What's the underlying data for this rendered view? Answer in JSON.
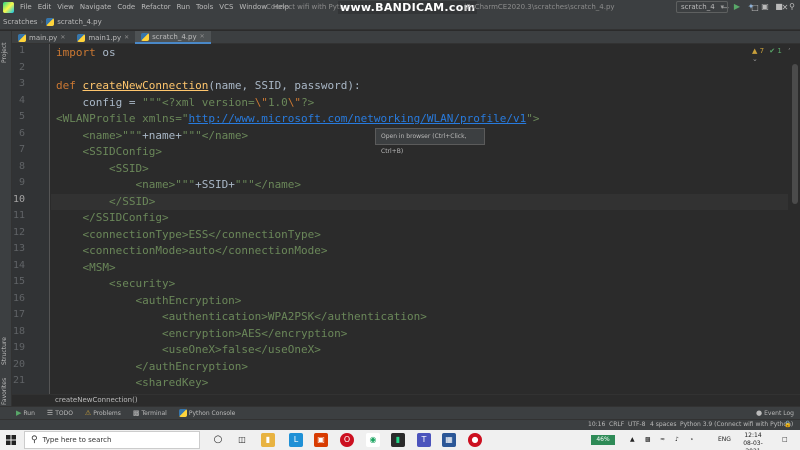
{
  "menu": [
    "File",
    "Edit",
    "View",
    "Navigate",
    "Code",
    "Refactor",
    "Run",
    "Tools",
    "VCS",
    "Window",
    "Help"
  ],
  "window": {
    "title_fragment": "Connect wifi with Python",
    "watermark": "www.BANDICAM.com",
    "path_fragment": "|PyCharmCE2020.3\\scratches\\scratch_4.py"
  },
  "nav": {
    "breadcrumb": [
      "Scratches",
      "scratch_4.py"
    ],
    "run_config": "scratch_4"
  },
  "tool_strip": {
    "project": "Project",
    "structure": "Structure",
    "favorites": "Favorites"
  },
  "tabs": [
    {
      "label": "main.py"
    },
    {
      "label": "main1.py"
    },
    {
      "label": "scratch_4.py"
    }
  ],
  "inspections": {
    "warnings": "▲ 7",
    "weak": "✔ 1"
  },
  "line_numbers": [
    "1",
    "2",
    "3",
    "4",
    "5",
    "6",
    "7",
    "8",
    "9",
    "10",
    "11",
    "12",
    "13",
    "14",
    "15",
    "16",
    "17",
    "18",
    "19",
    "20",
    "21"
  ],
  "code": {
    "l1_kw": "import",
    "l1_rest": " os",
    "l3_kw": "def ",
    "l3_fn": "createNewConnection",
    "l3_rest": "(name, SSID, password):",
    "l4_a": "    config = ",
    "l4_b": "\"\"\"<?xml version=",
    "l4_c": "\\\"",
    "l4_d": "1.0",
    "l4_e": "\\\"",
    "l4_f": "?>",
    "l5_a": "<WLANProfile ",
    "l5_b": "xmlns=\"",
    "l5_url": "http://www.microsoft.com/networking/WLAN/profile/v1",
    "l5_c": "\">",
    "l6_a": "    <name>\"\"\"",
    "l6_b": "+name+",
    "l6_c": "\"\"\"</name>",
    "l7": "    <SSIDConfig>",
    "l8": "        <SSID>",
    "l9_a": "            <name>\"\"\"",
    "l9_b": "+SSID+",
    "l9_c": "\"\"\"</name>",
    "l10": "        </SSID>",
    "l11": "    </SSIDConfig>",
    "l12": "    <connectionType>ESS</connectionType>",
    "l13": "    <connectionMode>auto</connectionMode>",
    "l14": "    <MSM>",
    "l15": "        <security>",
    "l16": "            <authEncryption>",
    "l17": "                <authentication>WPA2PSK</authentication>",
    "l18": "                <encryption>AES</encryption>",
    "l19": "                <useOneX>false</useOneX>",
    "l20": "            </authEncryption>",
    "l21": "            <sharedKey>"
  },
  "tooltip": "Open in browser (Ctrl+Click, Ctrl+B)",
  "breadcrumb_bottom": "createNewConnection()",
  "tool_windows": [
    "Run",
    "TODO",
    "Problems",
    "Terminal",
    "Python Console"
  ],
  "event_log": "Event Log",
  "status": {
    "position": "10:16",
    "line_sep": "CRLF",
    "encoding": "UTF-8",
    "indent": "4 spaces",
    "interpreter": "Python 3.9 (Connect wifi with Python)"
  },
  "taskbar": {
    "search_placeholder": "Type here to search",
    "battery": "46%",
    "language": "ENG",
    "time": "12:14",
    "date": "08-03-2021"
  }
}
